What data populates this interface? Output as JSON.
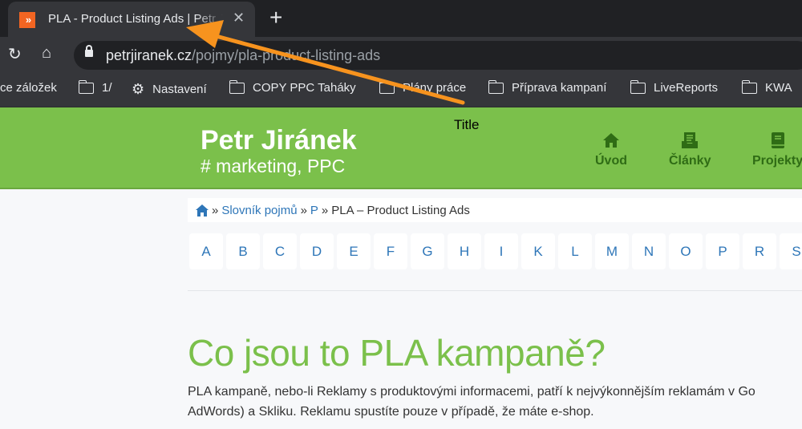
{
  "browser": {
    "tab_title": "PLA - Product Listing Ads | Petr Jiránek",
    "favicon_text": "»",
    "url_host": "petrjiranek.cz",
    "url_path": "/pojmy/pla-product-listing-ads",
    "bookmarks": [
      {
        "label": "ce záložek",
        "icon": "none"
      },
      {
        "label": "1/",
        "icon": "folder-icon"
      },
      {
        "label": "Nastavení",
        "icon": "gear-icon"
      },
      {
        "label": "COPY PPC Taháky",
        "icon": "folder-icon"
      },
      {
        "label": "Plány práce",
        "icon": "folder-icon"
      },
      {
        "label": "Příprava kampaní",
        "icon": "folder-icon"
      },
      {
        "label": "LiveReports",
        "icon": "folder-icon"
      },
      {
        "label": "KWA",
        "icon": "folder-icon"
      }
    ]
  },
  "site": {
    "name": "Petr Jiránek",
    "tagline": "# marketing, PPC",
    "nav": [
      {
        "label": "Úvod",
        "icon": "home-icon"
      },
      {
        "label": "Články",
        "icon": "articles-icon"
      },
      {
        "label": "Projekty",
        "icon": "book-icon"
      }
    ]
  },
  "annotation": {
    "label": "Title",
    "color": "#f7931e"
  },
  "breadcrumb": {
    "sep": "»",
    "items": [
      "Slovník pojmů",
      "P"
    ],
    "current": "PLA – Product Listing Ads"
  },
  "letters": [
    "A",
    "B",
    "C",
    "D",
    "E",
    "F",
    "G",
    "H",
    "I",
    "K",
    "L",
    "M",
    "N",
    "O",
    "P",
    "R",
    "S"
  ],
  "article": {
    "heading": "Co jsou to PLA kampaně?",
    "line1": "PLA kampaně, nebo-li Reklamy s produktovými informacemi, patří k nejvýkonnějším reklamám v Go",
    "line2": "AdWords) a Skliku. Reklamu spustíte pouze v případě, že máte e-shop."
  },
  "colors": {
    "brand_green": "#7bc04b",
    "link_blue": "#2e76b8",
    "nav_green": "#2f6c15"
  }
}
